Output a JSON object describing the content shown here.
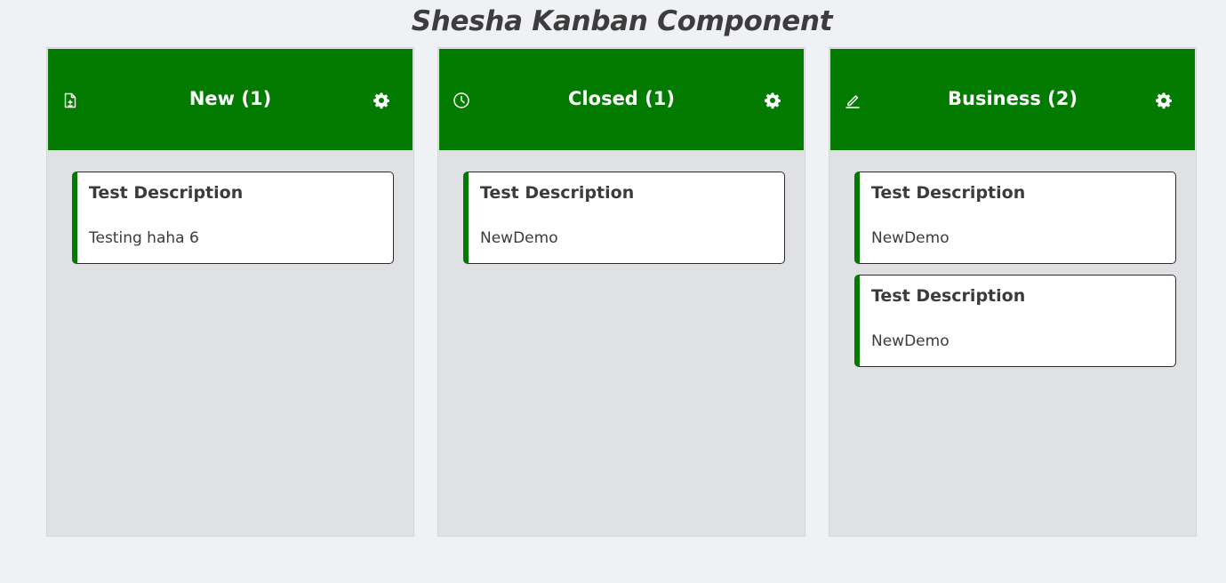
{
  "page": {
    "title": "Shesha Kanban Component"
  },
  "theme": {
    "accent": "#027b00",
    "column_bg": "#e0e1e5",
    "page_bg": "#f0f1f5"
  },
  "columns": [
    {
      "title": "New (1)",
      "icon": "file-add-icon",
      "settings_icon": "gear-icon",
      "cards": [
        {
          "title": "Test Description",
          "description": "Testing haha 6"
        }
      ]
    },
    {
      "title": "Closed (1)",
      "icon": "clock-icon",
      "settings_icon": "gear-icon",
      "cards": [
        {
          "title": "Test Description",
          "description": "NewDemo"
        }
      ]
    },
    {
      "title": "Business (2)",
      "icon": "edit-icon",
      "settings_icon": "gear-icon",
      "cards": [
        {
          "title": "Test Description",
          "description": "NewDemo"
        },
        {
          "title": "Test Description",
          "description": "NewDemo"
        }
      ]
    }
  ]
}
